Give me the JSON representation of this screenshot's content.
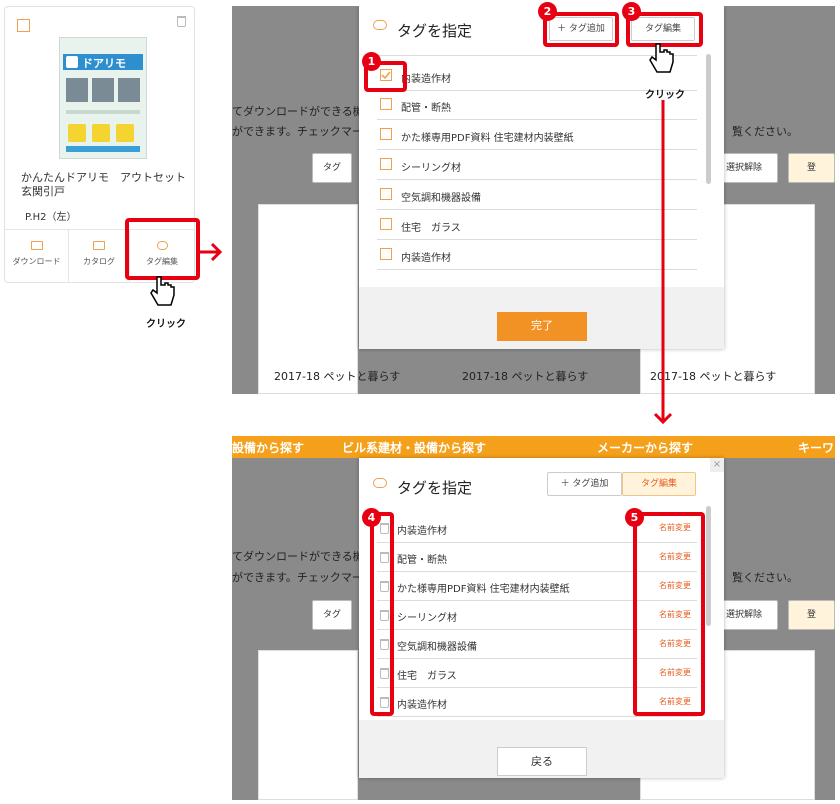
{
  "card": {
    "cover_title": "ドアリモ",
    "name": "かんたんドアリモ　アウトセット玄関引戸",
    "page": "P.H2（左）",
    "download_label": "ダウンロード",
    "catalog_label": "カタログ",
    "tag_edit_label": "タグ編集"
  },
  "click_label": "クリック",
  "modal": {
    "title": "タグを指定",
    "add_tag_label": "＋ タグ追加",
    "edit_tag_label": "タグ編集",
    "done_label": "完了",
    "back_label": "戻る",
    "rename_label": "名前変更",
    "close_label": "×",
    "tags": [
      "内装造作材",
      "配管・断熱",
      "かた様専用PDF資料 住宅建材内装壁紙",
      "シーリング材",
      "空気調和機器設備",
      "住宅　ガラス",
      "内装造作材"
    ]
  },
  "background": {
    "line1": "てダウンロードができる機",
    "line2": "ができます。チェックマーク",
    "right_text": "覧ください。",
    "deselect_label": "選択解除",
    "tag_btn_partial": "タグ",
    "reg_btn_partial": "登",
    "item_title": "2017-18 ペットと暮らす"
  },
  "nav": {
    "item1": "設備から探す",
    "item2": "ビル系建材・設備から探す",
    "item3": "メーカーから探す",
    "item4": "キーワ"
  },
  "badges": [
    "1",
    "2",
    "3",
    "4",
    "5"
  ],
  "colors": {
    "accent": "#f39224",
    "annotation_red": "#e60012",
    "checkbox": "#f0a050"
  }
}
